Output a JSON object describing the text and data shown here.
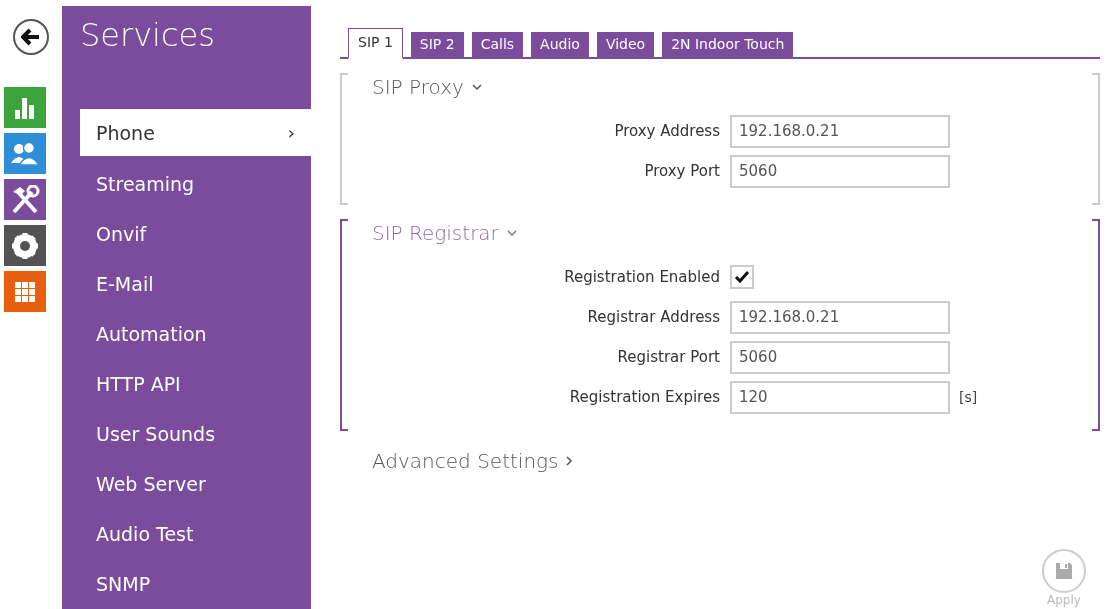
{
  "sidebar": {
    "title": "Services",
    "items": [
      {
        "label": "Phone",
        "selected": true,
        "arrow": "›"
      },
      {
        "label": "Streaming",
        "selected": false
      },
      {
        "label": "Onvif",
        "selected": false
      },
      {
        "label": "E-Mail",
        "selected": false
      },
      {
        "label": "Automation",
        "selected": false
      },
      {
        "label": "HTTP API",
        "selected": false
      },
      {
        "label": "User Sounds",
        "selected": false
      },
      {
        "label": "Web Server",
        "selected": false
      },
      {
        "label": "Audio Test",
        "selected": false
      },
      {
        "label": "SNMP",
        "selected": false
      }
    ]
  },
  "nav_icons": [
    {
      "kind": "chart",
      "color": "#3ba53b"
    },
    {
      "kind": "users",
      "color": "#2f8fd6"
    },
    {
      "kind": "tools",
      "color": "#7b4c9c"
    },
    {
      "kind": "gear",
      "color": "#535353"
    },
    {
      "kind": "grid",
      "color": "#e8600e"
    }
  ],
  "tabs": [
    {
      "label": "SIP 1",
      "selected": true
    },
    {
      "label": "SIP 2",
      "selected": false
    },
    {
      "label": "Calls",
      "selected": false
    },
    {
      "label": "Audio",
      "selected": false
    },
    {
      "label": "Video",
      "selected": false
    },
    {
      "label": "2N Indoor Touch",
      "selected": false
    }
  ],
  "sections": [
    {
      "title": "SIP Proxy",
      "expanded": true,
      "focused": false,
      "fields": [
        {
          "kind": "text",
          "label": "Proxy Address",
          "value": "192.168.0.21"
        },
        {
          "kind": "text",
          "label": "Proxy Port",
          "value": "5060"
        }
      ]
    },
    {
      "title": "SIP Registrar",
      "expanded": true,
      "focused": true,
      "fields": [
        {
          "kind": "checkbox",
          "label": "Registration Enabled",
          "checked": true
        },
        {
          "kind": "text",
          "label": "Registrar Address",
          "value": "192.168.0.21"
        },
        {
          "kind": "text",
          "label": "Registrar Port",
          "value": "5060"
        },
        {
          "kind": "text",
          "label": "Registration Expires",
          "value": "120",
          "unit": "[s]"
        }
      ]
    },
    {
      "title": "Advanced Settings",
      "expanded": false,
      "focused": false
    }
  ],
  "apply_button": {
    "label": "Apply"
  }
}
